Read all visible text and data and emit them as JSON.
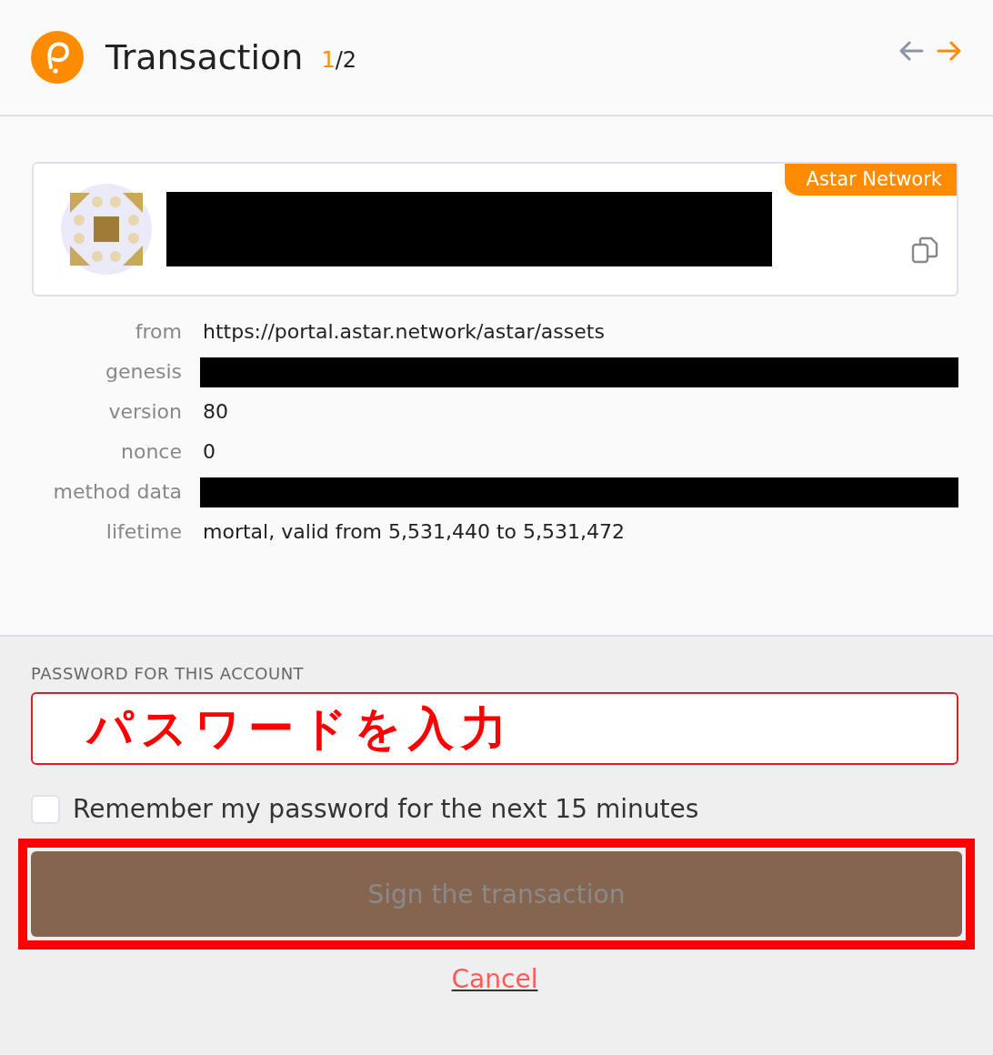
{
  "header": {
    "title": "Transaction",
    "counter_current": "1",
    "counter_total": "/2",
    "nav": [
      {
        "kind": "prev",
        "disabled": true
      },
      {
        "kind": "next",
        "disabled": false
      }
    ]
  },
  "account": {
    "network": "Astar Network",
    "name_redacted": true
  },
  "details": [
    {
      "label": "from",
      "value": "https://portal.astar.network/astar/assets",
      "redacted": false
    },
    {
      "label": "genesis",
      "redacted": true
    },
    {
      "label": "version",
      "value": "80",
      "redacted": false
    },
    {
      "label": "nonce",
      "value": "0",
      "redacted": false
    },
    {
      "label": "method data",
      "redacted": true
    },
    {
      "label": "lifetime",
      "value": "mortal, valid from 5,531,440 to 5,531,472",
      "redacted": false
    }
  ],
  "password": {
    "label": "PASSWORD FOR THIS ACCOUNT",
    "annotation": "パスワードを入力",
    "error": true
  },
  "remember": {
    "label": "Remember my password for the next 15 minutes",
    "checked": false
  },
  "sign_button": {
    "label": "Sign the transaction",
    "disabled": true,
    "highlighted": true
  },
  "cancel": "Cancel"
}
